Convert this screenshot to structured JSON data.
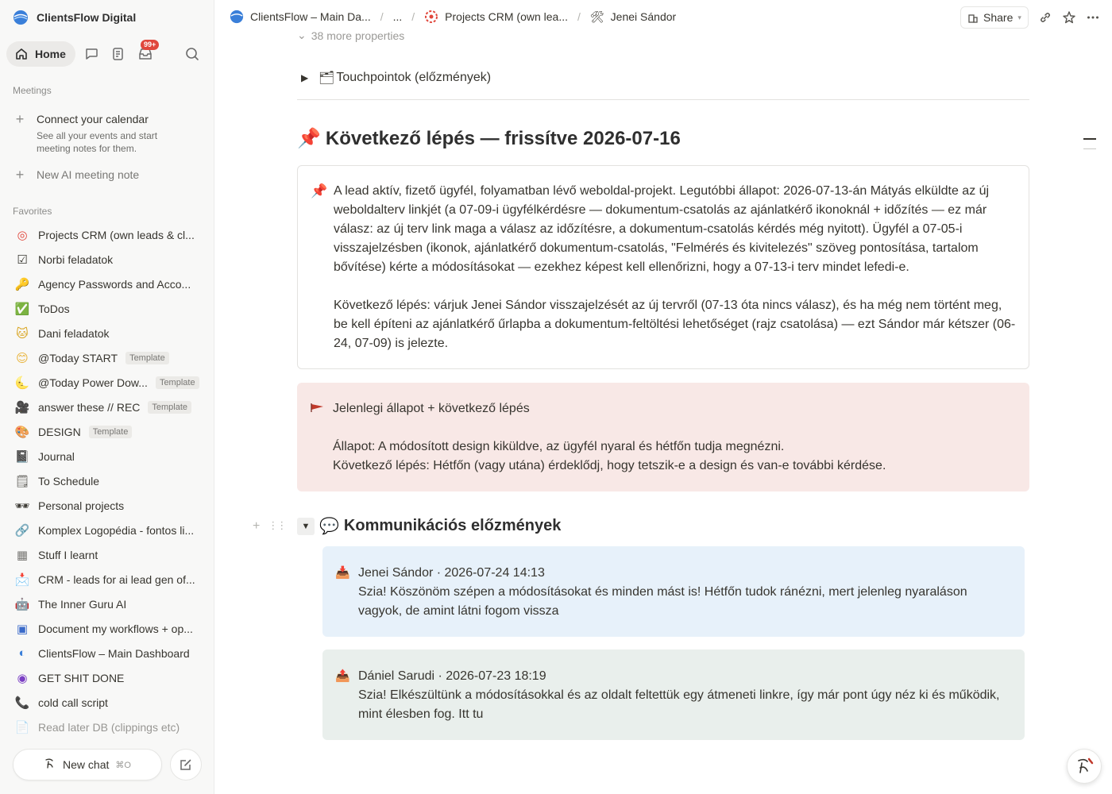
{
  "workspace": {
    "name": "ClientsFlow Digital"
  },
  "nav": {
    "home_label": "Home",
    "inbox_badge": "99+"
  },
  "meetings": {
    "heading": "Meetings",
    "connect_title": "Connect your calendar",
    "connect_desc": "See all your events and start meeting notes for them.",
    "new_note": "New AI meeting note"
  },
  "favorites": {
    "heading": "Favorites",
    "items": [
      {
        "label": "Projects CRM (own leads & cl...",
        "icon": "target-icon",
        "glyph": "◎",
        "color": "#e0473c"
      },
      {
        "label": "Norbi feladatok",
        "icon": "checkbox-icon",
        "glyph": "☑",
        "color": "#37352f"
      },
      {
        "label": "Agency Passwords and Acco...",
        "icon": "key-icon",
        "glyph": "🔑",
        "color": "#d9a521"
      },
      {
        "label": "ToDos",
        "icon": "check-icon",
        "glyph": "✅",
        "color": "#2e9e45"
      },
      {
        "label": "Dani feladatok",
        "icon": "cat-icon",
        "glyph": "🐱",
        "color": "#d9a521"
      },
      {
        "label": "@Today START",
        "icon": "smile-icon",
        "glyph": "😊",
        "color": "#e8b33a",
        "tag": "Template"
      },
      {
        "label": "@Today Power Dow...",
        "icon": "moon-icon",
        "glyph": "🌜",
        "color": "#e8b33a",
        "tag": "Template"
      },
      {
        "label": "answer these // REC",
        "icon": "camera-icon",
        "glyph": "🎥",
        "color": "#c9463d",
        "tag": "Template"
      },
      {
        "label": "DESIGN",
        "icon": "palette-icon",
        "glyph": "🎨",
        "color": "#c18a3a",
        "tag": "Template"
      },
      {
        "label": "Journal",
        "icon": "notebook-icon",
        "glyph": "📓",
        "color": "#37352f"
      },
      {
        "label": "To Schedule",
        "icon": "list-icon",
        "glyph": "🗒",
        "color": "#55534e"
      },
      {
        "label": "Personal projects",
        "icon": "sunglasses-icon",
        "glyph": "🕶",
        "color": "#37352f"
      },
      {
        "label": "Komplex Logopédia - fontos li...",
        "icon": "link-icon",
        "glyph": "🔗",
        "color": "#b5478c"
      },
      {
        "label": "Stuff I learnt",
        "icon": "table-icon",
        "glyph": "▦",
        "color": "#787774"
      },
      {
        "label": "CRM - leads for ai lead gen of...",
        "icon": "inbox-tray-icon",
        "glyph": "📩",
        "color": "#787774"
      },
      {
        "label": "The Inner Guru AI",
        "icon": "robot-icon",
        "glyph": "🤖",
        "color": "#787774"
      },
      {
        "label": "Document my workflows + op...",
        "icon": "chip-icon",
        "glyph": "▣",
        "color": "#3a6ac9"
      },
      {
        "label": "ClientsFlow – Main Dashboard",
        "icon": "globe-icon",
        "glyph": "◐",
        "color": "#3a7fd9"
      },
      {
        "label": "GET SHIT DONE",
        "icon": "target-purple-icon",
        "glyph": "◉",
        "color": "#7b3fc4"
      },
      {
        "label": "cold call script",
        "icon": "phone-icon",
        "glyph": "📞",
        "color": "#2e9e45"
      },
      {
        "label": "Read later DB (clippings etc)",
        "icon": "memo-icon",
        "glyph": "📄",
        "color": "#787774",
        "faded": true
      }
    ]
  },
  "bottom": {
    "new_chat": "New chat",
    "shortcut": "⌘O"
  },
  "topbar": {
    "crumb1": "ClientsFlow – Main Da...",
    "crumb_ellipsis": "...",
    "crumb2": "Projects CRM (own lea...",
    "crumb3": "Jenei Sándor",
    "share": "Share"
  },
  "page": {
    "more_properties": "38 more properties",
    "touchpoints": "Touchpointok (előzmények)",
    "next_step_heading": "Következő lépés — frissítve 2026-07-16",
    "summary_p1": "A lead aktív, fizető ügyfél, folyamatban lévő weboldal-projekt. Legutóbbi állapot: 2026-07-13-án Mátyás elküldte az új weboldalterv linkjét (a 07-09-i ügyfélkérdésre — dokumentum-csatolás az ajánlatkérő ikonoknál + időzítés — ez már válasz: az új terv link maga a válasz az időzítésre, a dokumentum-csatolás kérdés még nyitott). Ügyfél a 07-05-i visszajelzésben (ikonok, ajánlatkérő dokumentum-csatolás, \"Felmérés és kivitelezés\" szöveg pontosítása, tartalom bővítése) kérte a módosításokat — ezekhez képest kell ellenőrizni, hogy a 07-13-i terv mindet lefedi-e.",
    "summary_p2": "Következő lépés: várjuk Jenei Sándor visszajelzését az új tervről (07-13 óta nincs válasz), és ha még nem történt meg, be kell építeni az ajánlatkérő űrlapba a dokumentum-feltöltési lehetőséget (rajz csatolása) — ezt Sándor már kétszer (06-24, 07-09) is jelezte.",
    "status_title": "Jelenlegi állapot + következő lépés",
    "status_line1": "Állapot: A módosított design kiküldve, az ügyfél nyaral és hétfőn tudja megnézni.",
    "status_line2": "Következő lépés: Hétfőn (vagy utána) érdeklődj, hogy tetszik-e a design és van-e további kérdése.",
    "comm_heading": "Kommunikációs előzmények",
    "messages": [
      {
        "header": "Jenei Sándor · 2026-07-24 14:13",
        "text": "Szia! Köszönöm szépen a módosításokat és minden mást is! Hétfőn tudok ránézni, mert jelenleg nyaraláson vagyok, de amint látni fogom vissza"
      },
      {
        "header": "Dániel Sarudi · 2026-07-23 18:19",
        "text": "Szia! Elkészültünk a módosításokkal és az oldalt feltettük egy átmeneti linkre, így már pont úgy néz ki és működik, mint élesben fog. Itt tu"
      }
    ]
  }
}
